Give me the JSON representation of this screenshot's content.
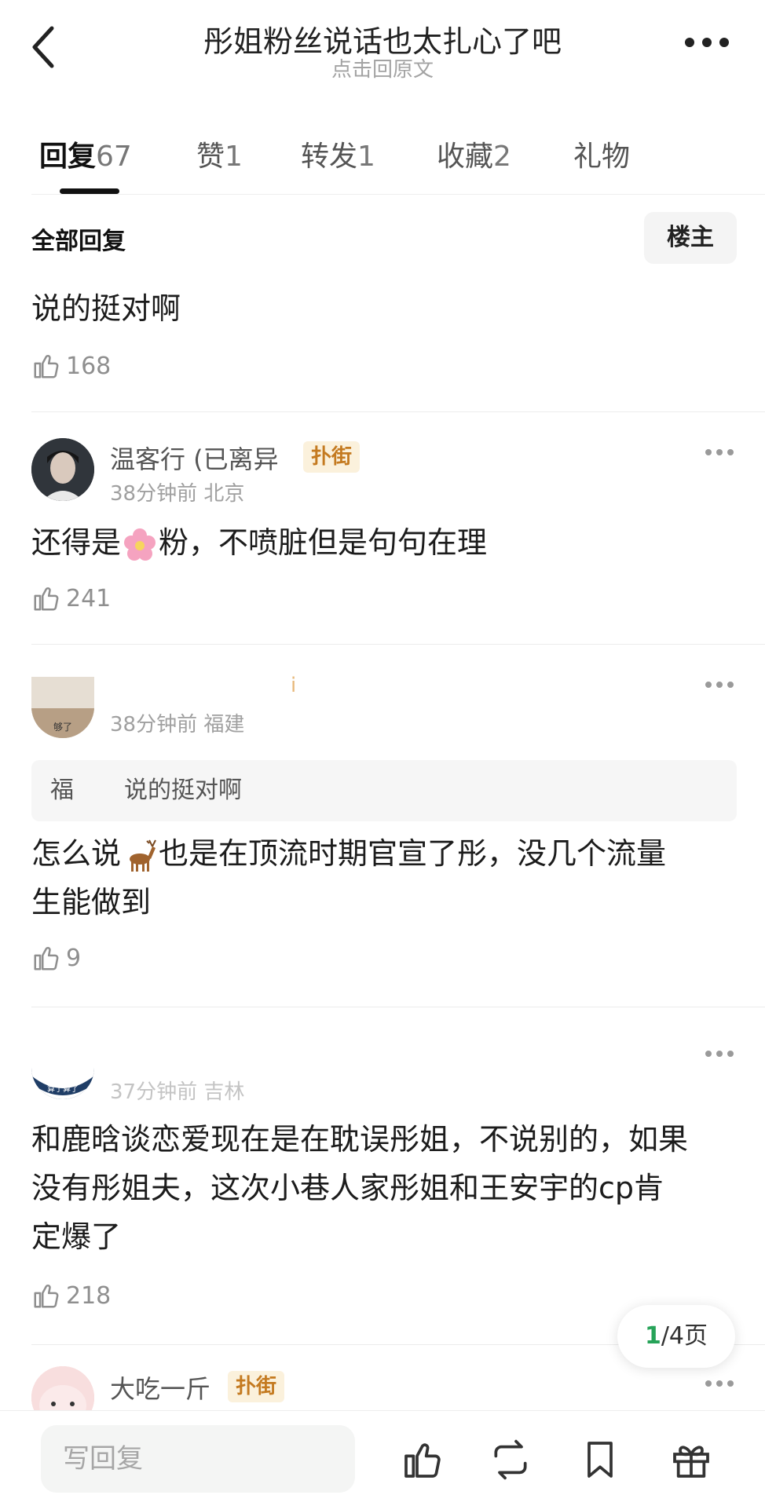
{
  "header": {
    "back_icon": "chevron-left-icon",
    "title": "彤姐粉丝说话也太扎心了吧",
    "subtitle": "点击回原文",
    "more_icon": "more-horizontal-icon"
  },
  "tabs": [
    {
      "label": "回复",
      "count": "67",
      "active": true
    },
    {
      "label": "赞",
      "count": "1"
    },
    {
      "label": "转发",
      "count": "1"
    },
    {
      "label": "收藏",
      "count": "2"
    },
    {
      "label": "礼物",
      "count": ""
    }
  ],
  "section": {
    "title": "全部回复",
    "filter_label": "楼主"
  },
  "comments": [
    {
      "text": "说的挺对啊",
      "likes": "168"
    },
    {
      "username": "温客行 (已离异",
      "badge": "扑街",
      "time": "38分钟前",
      "location": "北京",
      "text_before": "还得是",
      "emoji": "cherry-blossom-emoji",
      "text_after": "粉，不喷脏但是句句在理",
      "likes": "241"
    },
    {
      "username_fragment": "i",
      "time": "38分钟前",
      "location": "福建",
      "avatar_caption": "够了",
      "quote_author": "福",
      "quote_text": "说的挺对啊",
      "text_before": "怎么说",
      "emoji": "deer-emoji",
      "text_line1_after": "也是在顶流时期官宣了彤，没几个流量",
      "text_line2": "生能做到",
      "likes": "9"
    },
    {
      "meta_partial": "37分钟前 吉林",
      "avatar_caption": "算了算了",
      "text_lines": [
        "和鹿晗谈恋爱现在是在耽误彤姐，不说别的，如果",
        "没有彤姐夫，这次小巷人家彤姐和王安宇的cp肯",
        "定爆了"
      ],
      "likes": "218"
    },
    {
      "username": "大吃一斤",
      "badge": "扑街"
    }
  ],
  "pager": {
    "current": "1",
    "total_text": "/4页"
  },
  "bottom_bar": {
    "reply_placeholder": "写回复",
    "icons": [
      "thumbs-up-icon",
      "repost-icon",
      "bookmark-icon",
      "gift-icon"
    ]
  },
  "colors": {
    "accent_green": "#27a359",
    "badge_bg": "#fbf1dc",
    "badge_text": "#c47a20"
  }
}
